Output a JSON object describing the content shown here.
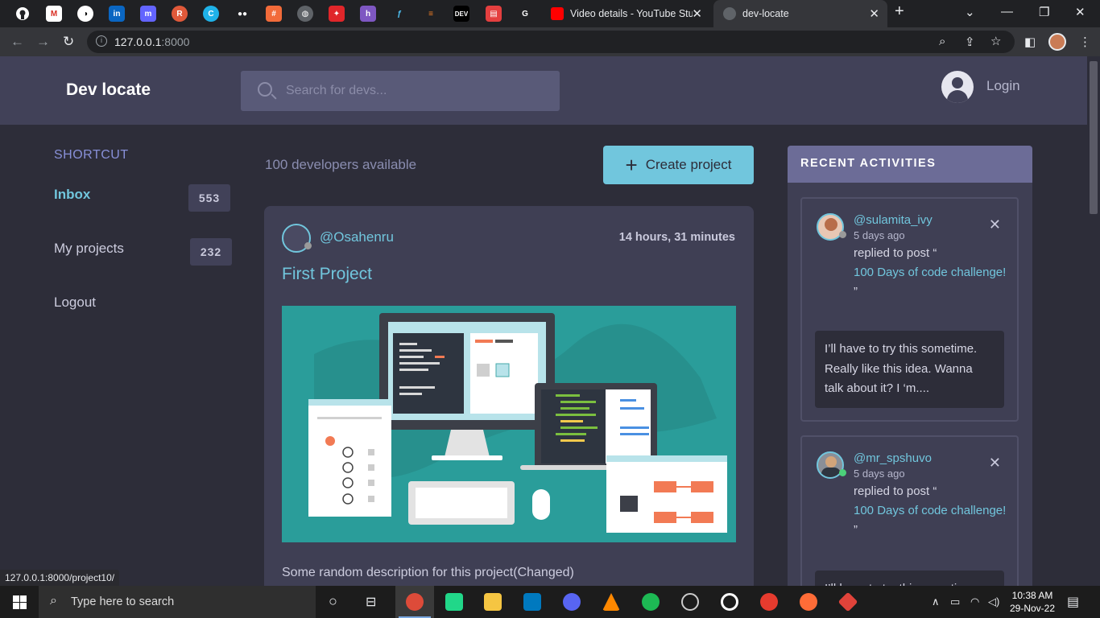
{
  "browser": {
    "tabs": [
      {
        "title": "Video details - YouTube Studio",
        "active": false
      },
      {
        "title": "dev-locate",
        "active": true
      }
    ],
    "url_host": "127.0.0.1",
    "url_port": ":8000",
    "status_url": "127.0.0.1:8000/project10/"
  },
  "header": {
    "logo": "Dev locate",
    "search_placeholder": "Search for devs...",
    "login_label": "Login"
  },
  "shortcuts": {
    "title": "SHORTCUT",
    "items": [
      {
        "label": "Inbox",
        "count": "553"
      },
      {
        "label": "My projects",
        "count": "232"
      },
      {
        "label": "Logout"
      }
    ]
  },
  "main": {
    "dev_count": "100 developers available",
    "create_label": "Create project",
    "project": {
      "user": "@Osahenru",
      "time": "14 hours, 31 minutes",
      "title": "First Project",
      "description": "Some random description for this project(Changed)"
    }
  },
  "activities": {
    "title": "RECENT ACTIVITIES",
    "items": [
      {
        "user": "@sulamita_ivy",
        "ago": "5 days ago",
        "action": "replied to post “",
        "post": "100 Days of code challenge!",
        "close_quote": "”",
        "quote": "I’ll have to try this sometime. Really like this idea. Wanna talk about it? I ‘m...."
      },
      {
        "user": "@mr_spshuvo",
        "ago": "5 days ago",
        "action": "replied to post “",
        "post": "100 Days of code challenge!",
        "close_quote": "”",
        "quote": "I’ll have to try this sometime."
      }
    ]
  },
  "taskbar": {
    "search_placeholder": "Type here to search",
    "time": "10:38 AM",
    "date": "29-Nov-22"
  },
  "colors": {
    "accent": "#71c6dd",
    "header": "#414158",
    "background": "#2d2d39",
    "card": "#3f3f54"
  }
}
